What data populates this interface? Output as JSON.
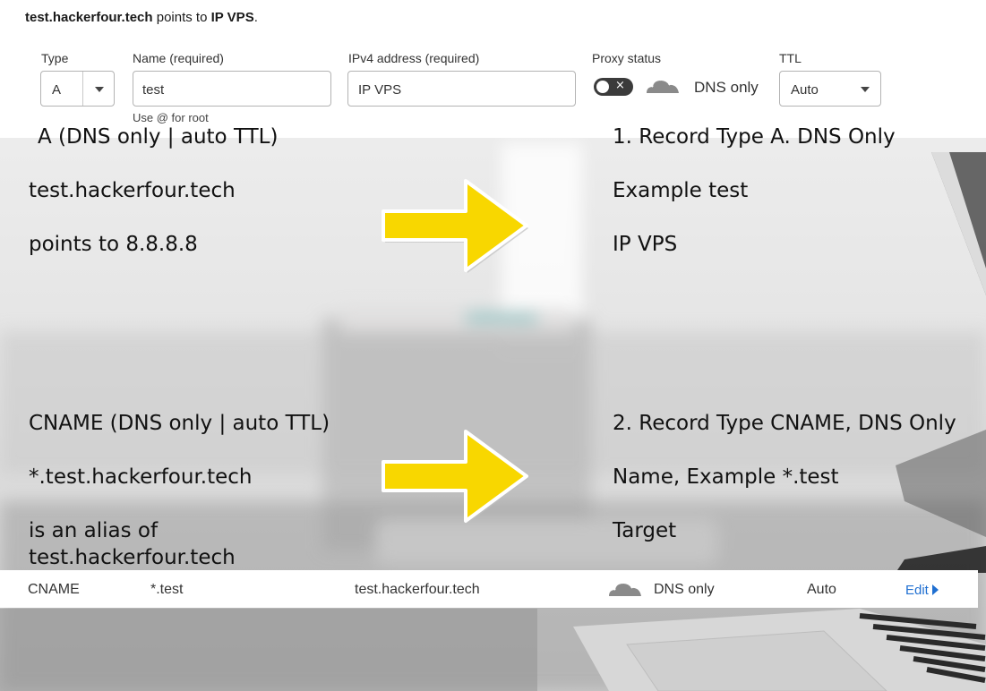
{
  "form": {
    "heading_domain": "test.hackerfour.tech",
    "heading_mid": " points to ",
    "heading_target": "IP VPS",
    "heading_end": ".",
    "type_label": "Type",
    "type_value": "A",
    "name_label": "Name (required)",
    "name_value": "test",
    "name_help": "Use @ for root",
    "ipv4_label": "IPv4 address (required)",
    "ipv4_value": "IP VPS",
    "proxy_label": "Proxy status",
    "proxy_toggle_mark": "×",
    "proxy_value": "DNS only",
    "ttl_label": "TTL",
    "ttl_value": "Auto"
  },
  "notes": {
    "record_a": {
      "left_line1": "A (DNS only | auto TTL)",
      "left_line2": "test.hackerfour.tech",
      "left_line3": "points to 8.8.8.8",
      "right_line1": "1. Record Type A. DNS Only",
      "right_line2": "Example test",
      "right_line3": "IP VPS"
    },
    "record_cname": {
      "left_line1": "CNAME (DNS only | auto TTL)",
      "left_line2": "*.test.hackerfour.tech",
      "left_line3": "is an alias of",
      "left_line4": "test.hackerfour.tech",
      "right_line1": "2. Record Type CNAME, DNS Only",
      "right_line2": "Name, Example *.test",
      "right_line3": "Target"
    }
  },
  "row": {
    "type": "CNAME",
    "name": "*.test",
    "content": "test.hackerfour.tech",
    "proxy": "DNS only",
    "ttl": "Auto",
    "edit": "Edit"
  },
  "colors": {
    "arrow": "#f8d700",
    "link": "#1f6fd1",
    "toggle": "#3b3b3b"
  },
  "icons": [
    "cloud-icon",
    "chevron-down-icon",
    "arrow-right-icon",
    "caret-right-icon"
  ]
}
